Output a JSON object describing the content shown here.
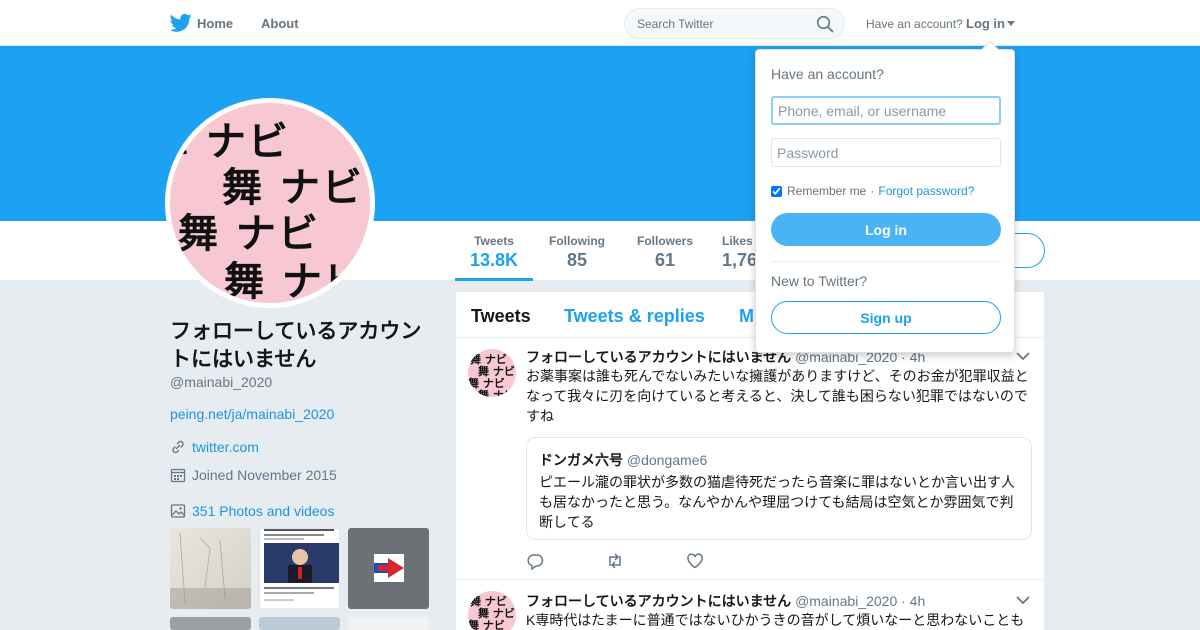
{
  "nav": {
    "home_label": "Home",
    "about_label": "About",
    "search_placeholder": "Search Twitter",
    "have_account": "Have an account?",
    "login_label": "Log in"
  },
  "profile": {
    "avatar_text": "舞 ナビ",
    "name": "フォローしているアカウントにはいません",
    "handle": "@mainabi_2020",
    "bio_link": "peing.net/ja/mainabi_2020",
    "website": "twitter.com",
    "joined": "Joined November 2015",
    "photos": "351 Photos and videos"
  },
  "stats": [
    {
      "label": "Tweets",
      "value": "13.8K"
    },
    {
      "label": "Following",
      "value": "85"
    },
    {
      "label": "Followers",
      "value": "61"
    },
    {
      "label": "Likes",
      "value": "1,76"
    }
  ],
  "timeline_tabs": [
    "Tweets",
    "Tweets & replies",
    "M"
  ],
  "tweets": [
    {
      "name": "フォローしているアカウントにはいません",
      "handle": "@mainabi_2020",
      "time": "· 4h",
      "text": "お薬事案は誰も死んでないみたいな擁護がありますけど、そのお金が犯罪収益となって我々に刃を向けていると考えると、決して誰も困らない犯罪ではないのですね",
      "quote": {
        "name": "ドンガメ六号",
        "handle": "@dongame6",
        "text": "ピエール瀧の罪状が多数の猫虐待死だったら音楽に罪はないとか言い出す人も居なかったと思う。なんやかんや理屈つけても結局は空気とか雰囲気で判断してる"
      }
    },
    {
      "name": "フォローしているアカウントにはいません",
      "handle": "@mainabi_2020",
      "time": "· 4h",
      "text": "K専時代はたまーに普通ではないひかうきの音がして煩いなーと思わないことも"
    }
  ],
  "login_dropdown": {
    "title": "Have an account?",
    "username_placeholder": "Phone, email, or username",
    "password_placeholder": "Password",
    "remember": "Remember me",
    "forgot": "Forgot password?",
    "login_button": "Log in",
    "new_text": "New to Twitter?",
    "signup_button": "Sign up"
  },
  "colors": {
    "brand": "#1da1f2",
    "banner": "#1da1f2",
    "avatar_bg": "#f7c8d3"
  }
}
